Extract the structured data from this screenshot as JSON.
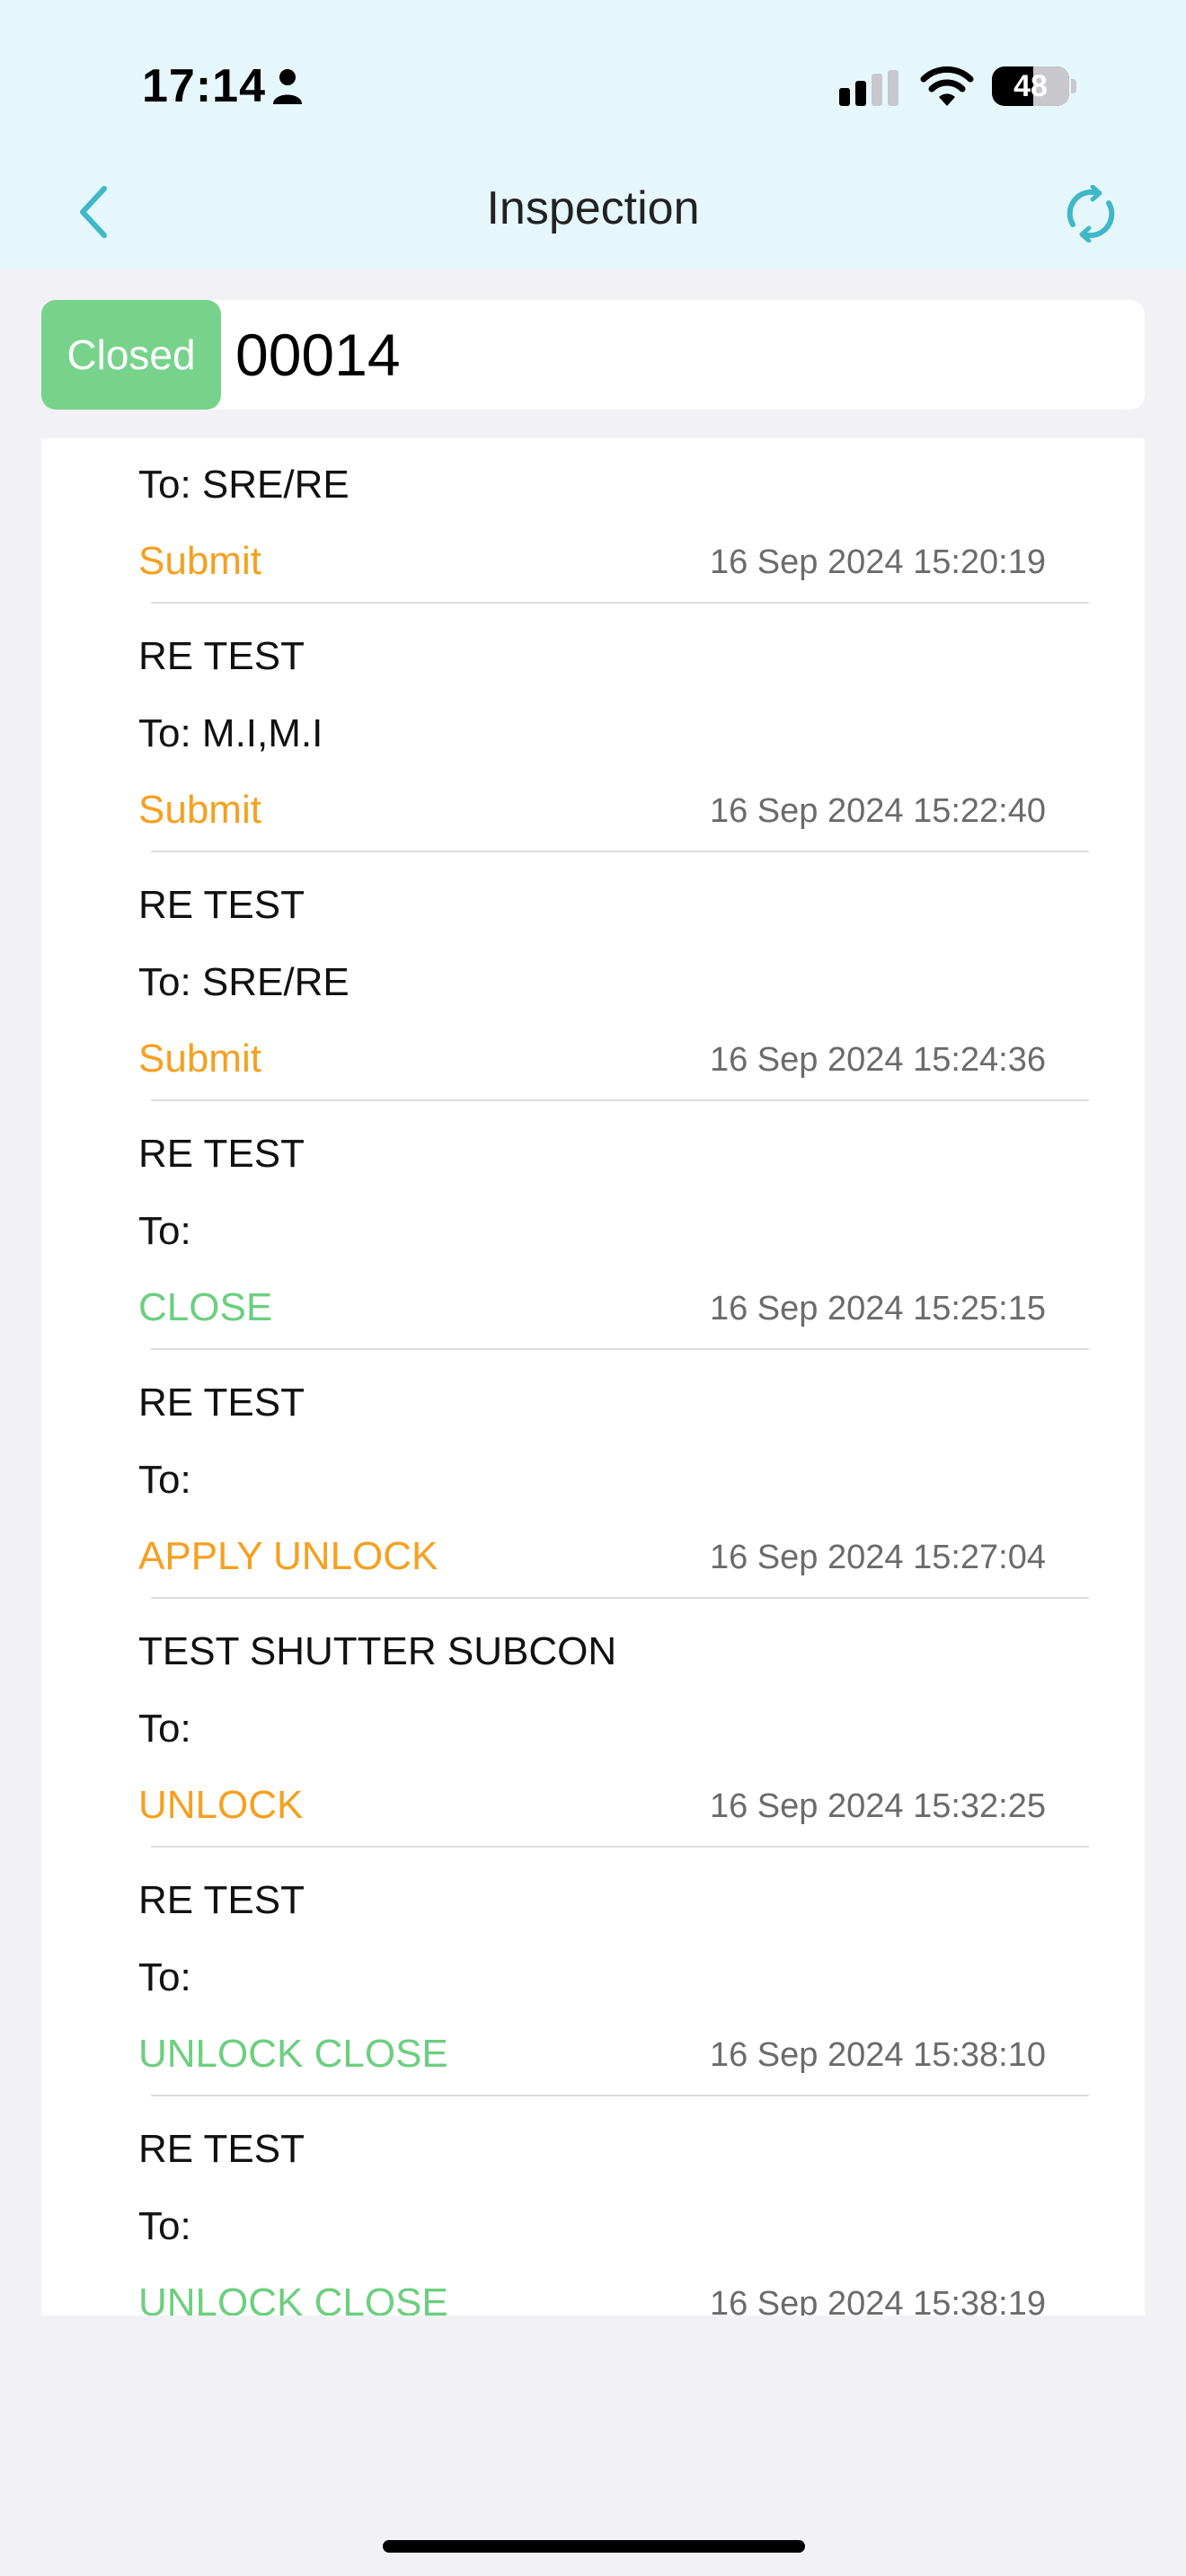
{
  "status_bar": {
    "time": "17:14",
    "battery": "48"
  },
  "nav": {
    "title": "Inspection"
  },
  "record": {
    "status": "Closed",
    "number": "00014"
  },
  "colors": {
    "submit": "#f5a01f",
    "close": "#6ccf7f",
    "badge": "#77d38b",
    "accent": "#3fb8c8"
  },
  "entries": [
    {
      "by": "",
      "to": "To: SRE/RE",
      "action": "Submit",
      "kind": "submit",
      "time": "16 Sep 2024 15:20:19"
    },
    {
      "by": "RE TEST",
      "to": "To: M.I,M.I",
      "action": "Submit",
      "kind": "submit",
      "time": "16 Sep 2024 15:22:40"
    },
    {
      "by": "RE TEST",
      "to": "To: SRE/RE",
      "action": "Submit",
      "kind": "submit",
      "time": "16 Sep 2024 15:24:36"
    },
    {
      "by": "RE TEST",
      "to": "To:",
      "action": "CLOSE",
      "kind": "close",
      "time": "16 Sep 2024 15:25:15"
    },
    {
      "by": "RE TEST",
      "to": "To:",
      "action": "APPLY UNLOCK",
      "kind": "submit",
      "time": "16 Sep 2024 15:27:04"
    },
    {
      "by": "TEST SHUTTER SUBCON",
      "to": "To:",
      "action": "UNLOCK",
      "kind": "submit",
      "time": "16 Sep 2024 15:32:25"
    },
    {
      "by": "RE TEST",
      "to": "To:",
      "action": "UNLOCK CLOSE",
      "kind": "close",
      "time": "16 Sep 2024 15:38:10"
    },
    {
      "by": "RE TEST",
      "to": "To:",
      "action": "UNLOCK CLOSE",
      "kind": "close",
      "time": "16 Sep 2024 15:38:19"
    }
  ]
}
